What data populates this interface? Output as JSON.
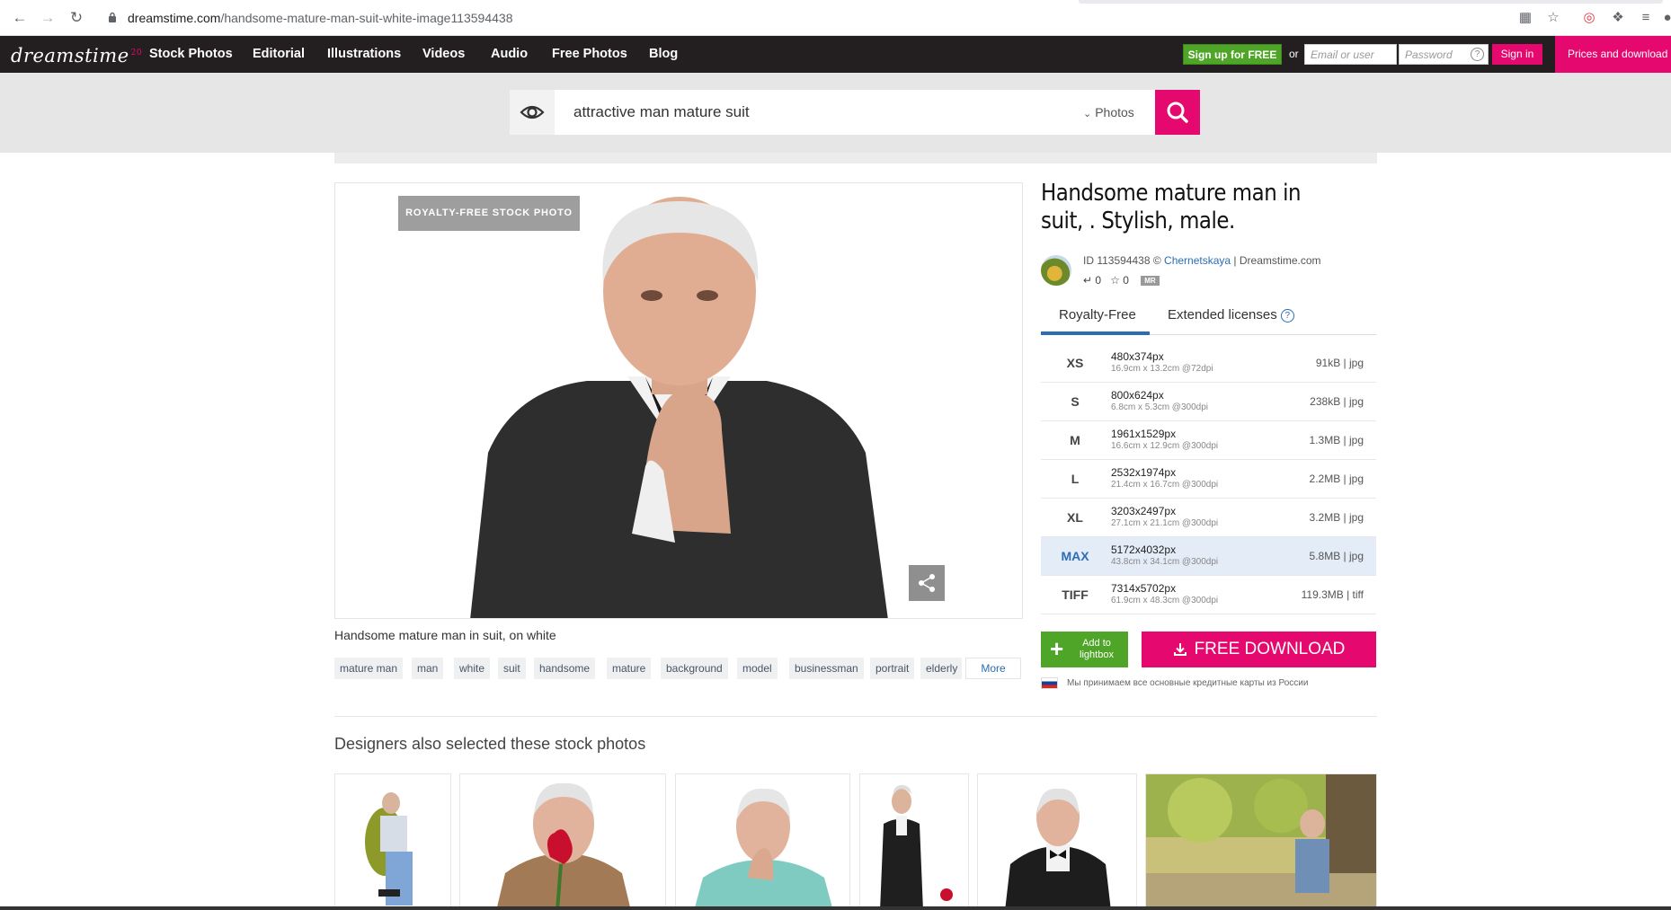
{
  "browser": {
    "url_host": "dreamstime.com",
    "url_path": "/handsome-mature-man-suit-white-image113594438"
  },
  "site": {
    "logo": "dreamstime",
    "logo_badge": "20",
    "nav": [
      "Stock Photos",
      "Editorial",
      "Illustrations",
      "Videos",
      "Audio",
      "Free Photos",
      "Blog"
    ],
    "signup_label": "Sign up for FREE",
    "or_label": "or",
    "email_placeholder": "Email or user",
    "password_placeholder": "Password",
    "help_label": "?",
    "signin_label": "Sign in",
    "prices_label": "Prices and download"
  },
  "search": {
    "query": "attractive man mature suit",
    "type_label": "Photos",
    "type_caret": "⌄"
  },
  "image": {
    "badge": "ROYALTY-FREE STOCK PHOTO",
    "caption": "Handsome mature man in suit, on white",
    "tags": [
      "mature man",
      "man",
      "white",
      "suit",
      "handsome",
      "mature",
      "background",
      "model",
      "businessman",
      "portrait",
      "elderly"
    ],
    "more_label": "More"
  },
  "details": {
    "title": "Handsome mature man in suit, . Stylish, male.",
    "id_prefix": "ID 113594438 © ",
    "author": "Chernetskaya",
    "site_suffix": " | Dreamstime.com",
    "downloads": "0",
    "favorites": "0",
    "mr_badge": "MR",
    "tabs": [
      "Royalty-Free",
      "Extended licenses"
    ],
    "help_icon": "?",
    "sizes": [
      {
        "code": "XS",
        "dims": "480x374px",
        "phys": "16.9cm x 13.2cm @72dpi",
        "file": "91kB | jpg"
      },
      {
        "code": "S",
        "dims": "800x624px",
        "phys": "6.8cm x 5.3cm @300dpi",
        "file": "238kB | jpg"
      },
      {
        "code": "M",
        "dims": "1961x1529px",
        "phys": "16.6cm x 12.9cm @300dpi",
        "file": "1.3MB | jpg"
      },
      {
        "code": "L",
        "dims": "2532x1974px",
        "phys": "21.4cm x 16.7cm @300dpi",
        "file": "2.2MB | jpg"
      },
      {
        "code": "XL",
        "dims": "3203x2497px",
        "phys": "27.1cm x 21.1cm @300dpi",
        "file": "3.2MB | jpg"
      },
      {
        "code": "MAX",
        "dims": "5172x4032px",
        "phys": "43.8cm x 34.1cm @300dpi",
        "file": "5.8MB | jpg"
      },
      {
        "code": "TIFF",
        "dims": "7314x5702px",
        "phys": "61.9cm x 48.3cm @300dpi",
        "file": "119.3MB | tiff"
      }
    ],
    "selected_size": "MAX",
    "add_lightbox_label": "Add to lightbox",
    "free_download_label": "FREE DOWNLOAD",
    "russia_note": "Мы принимаем все основные кредитные карты из России"
  },
  "related": {
    "heading": "Designers also selected these stock photos"
  },
  "colors": {
    "brand_pink": "#e5086f",
    "signup_green": "#4fa527",
    "link_blue": "#2c6db5"
  }
}
